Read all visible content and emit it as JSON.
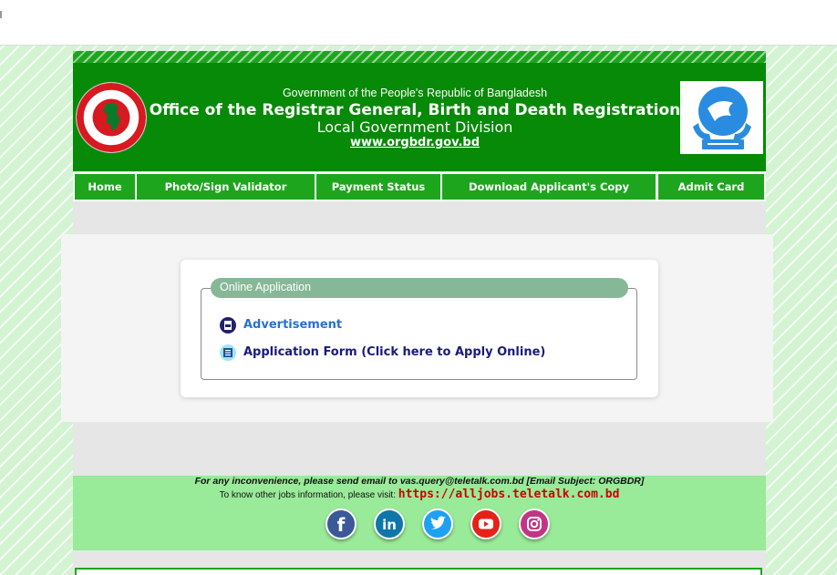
{
  "header": {
    "gov_line": "Government of the People's Republic of Bangladesh",
    "office_title": "Office of the Registrar General, Birth and Death Registration",
    "division": "Local Government Division",
    "website": "www.orgbdr.gov.bd",
    "left_emblem_icon": "bangladesh-government-seal-icon",
    "right_logo_icon": "birth-registration-logo-icon",
    "colors": {
      "header_bg": "#078a07",
      "nav_bg": "#1ea51e"
    }
  },
  "nav": {
    "items": [
      {
        "label": "Home"
      },
      {
        "label": "Photo/Sign Validator"
      },
      {
        "label": "Payment Status"
      },
      {
        "label": "Download Applicant's Copy"
      },
      {
        "label": "Admit Card"
      }
    ]
  },
  "main": {
    "section_title": "Online Application",
    "links": [
      {
        "label": "Advertisement",
        "icon": "pdf-icon"
      },
      {
        "label": "Application Form (Click here to Apply Online)",
        "icon": "form-icon"
      }
    ]
  },
  "footer": {
    "email_line": "For any inconvenience, please send email to vas.query@teletalk.com.bd  [Email Subject: ORGBDR]",
    "jobs_prefix": "To know other jobs information, please visit:",
    "jobs_link": "https://alljobs.teletalk.com.bd",
    "social": [
      {
        "name": "facebook-icon",
        "color": "#3b5998"
      },
      {
        "name": "linkedin-icon",
        "color": "#0e76a8"
      },
      {
        "name": "twitter-icon",
        "color": "#1da1f2"
      },
      {
        "name": "youtube-icon",
        "color": "#e62117"
      },
      {
        "name": "instagram-icon",
        "color": "#c13584"
      }
    ]
  }
}
